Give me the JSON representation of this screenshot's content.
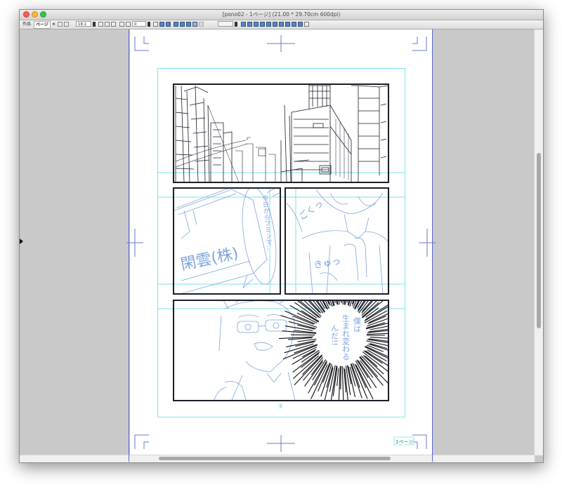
{
  "window": {
    "title": "[pono02 - 1ページ] (21.00 * 29.70cm 600dpi)"
  },
  "toolbar": {
    "tab_work": "作品",
    "tab_page": "ページ",
    "tab_close": "×",
    "zoom_value": "18.1",
    "rotate_value": "0"
  },
  "canvas": {
    "page_number_marker": "①",
    "page_name_label": "1ページ"
  },
  "manga": {
    "panel2_caption": "今日からフミンで…",
    "panel2_sign": "閑雲(株)",
    "panel3_sfx1": "ごくっ",
    "panel3_sfx2": "きゅっ",
    "panel4_line1": "僕は",
    "panel4_line2": "生まれ変わる",
    "panel4_line3": "んだ!!"
  },
  "colors": {
    "pencil": "#7fa3df",
    "guide": "#7ee3ee",
    "ink": "#1c1c2a",
    "page_edge": "#5566cc"
  }
}
